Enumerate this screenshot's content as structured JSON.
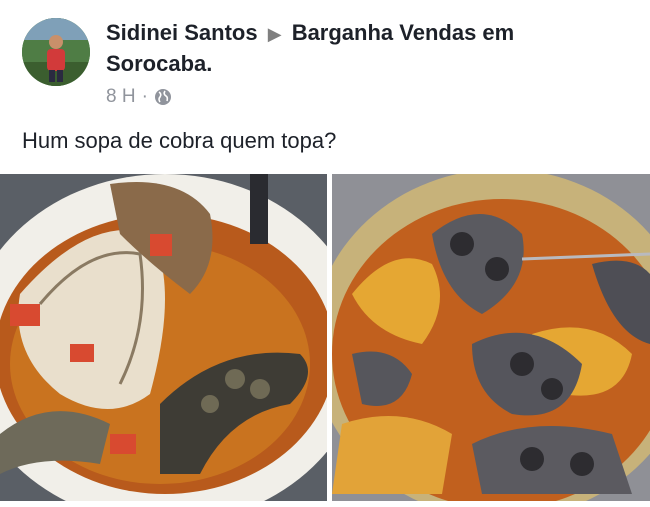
{
  "post": {
    "author": "Sidinei Santos",
    "arrow": "▶",
    "group_line1": "Barganha Vendas em",
    "group_line2": "Sorocaba.",
    "time": "8 H",
    "separator": "·",
    "privacy_icon": "globe-icon",
    "text": "Hum  sopa de cobra quem topa?"
  },
  "photos": {
    "left_icon": "snake-soup-bowl-photo",
    "right_icon": "snake-pot-photo"
  }
}
